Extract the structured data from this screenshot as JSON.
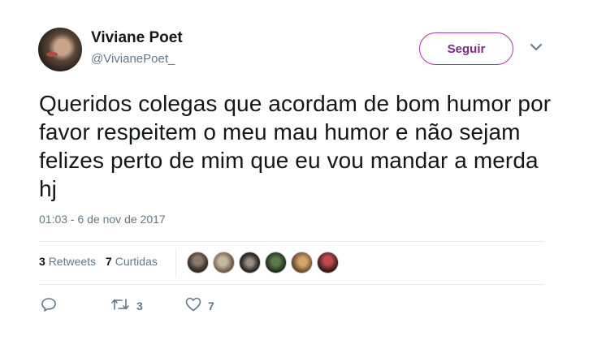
{
  "author": {
    "name": "Viviane Poet",
    "handle": "@VivianePoet_"
  },
  "follow_label": "Seguir",
  "tweet": {
    "text": "Queridos colegas que acordam de bom humor por favor respeitem o meu mau humor e não sejam felizes perto de mim que eu vou mandar a merda hj",
    "timestamp": "01:03 - 6 de nov de 2017"
  },
  "stats": {
    "retweets_count": "3",
    "retweets_label": "Retweets",
    "likes_count": "7",
    "likes_label": "Curtidas"
  },
  "actions": {
    "reply_count": "",
    "retweet_count": "3",
    "like_count": "7"
  },
  "colors": {
    "follow_accent": "#9c3fa0",
    "muted_text": "#657786"
  }
}
